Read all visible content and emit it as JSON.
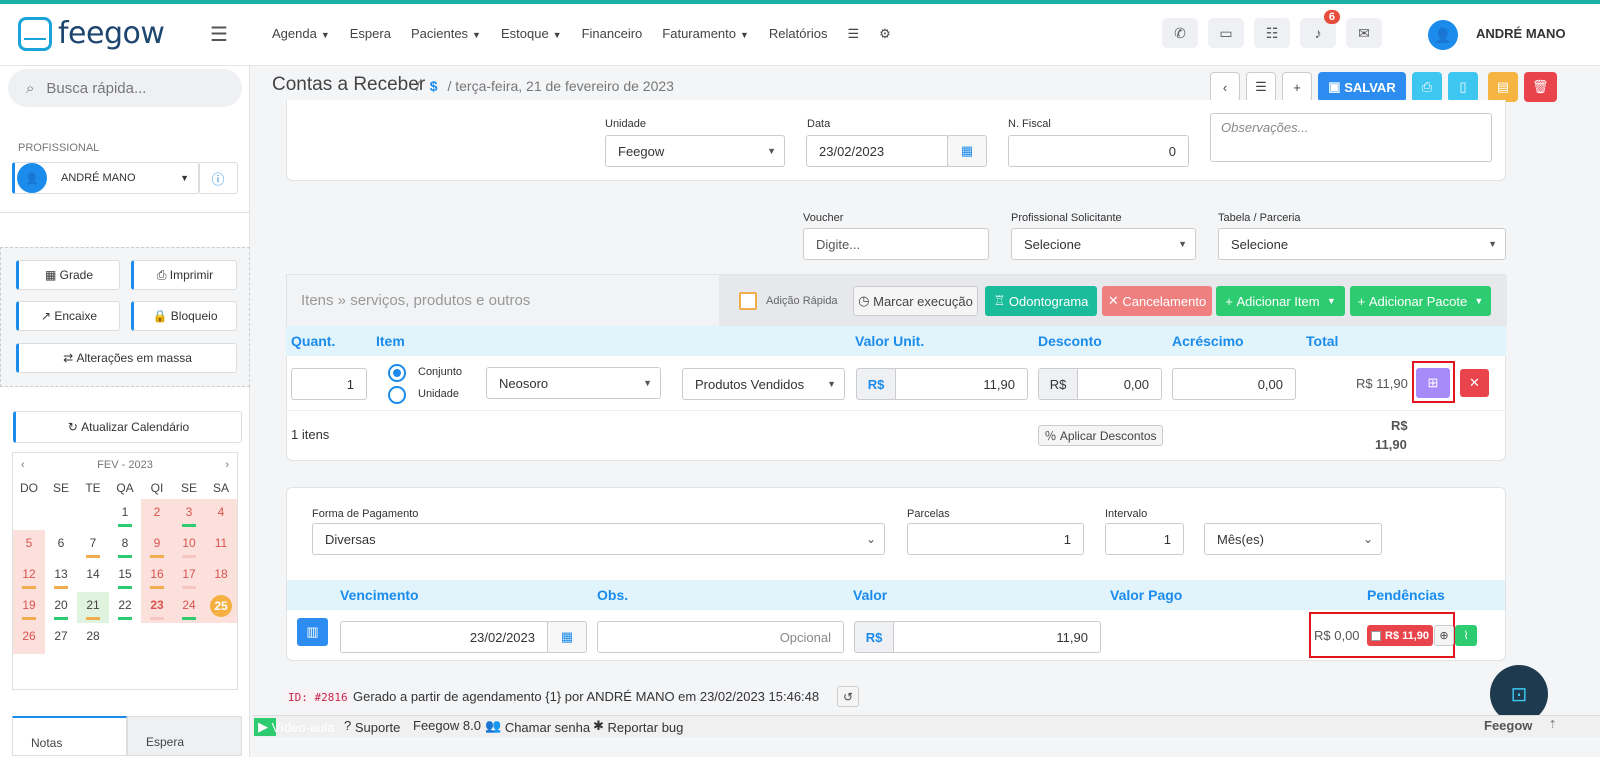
{
  "app": {
    "logo_text": "feegow",
    "user": "ANDRÉ MANO",
    "notifications_count": "6"
  },
  "nav": [
    "Agenda",
    "Espera",
    "Pacientes",
    "Estoque",
    "Financeiro",
    "Faturamento",
    "Relatórios"
  ],
  "nav_dropdowns": [
    true,
    false,
    true,
    true,
    false,
    true,
    false
  ],
  "sidebar": {
    "search_placeholder": "Busca rápida...",
    "professional_label": "PROFISSIONAL",
    "professional_value": "ANDRÉ MANO",
    "buttons": {
      "grade": "Grade",
      "imprimir": "Imprimir",
      "encaixe": "Encaixe",
      "bloqueio": "Bloqueio",
      "alteracoes": "Alterações em massa",
      "atualizar": "Atualizar Calendário"
    },
    "calendar": {
      "month": "FEV - 2023",
      "dow": [
        "DO",
        "SE",
        "TE",
        "QA",
        "QI",
        "SE",
        "SA"
      ],
      "days": [
        "",
        "",
        "",
        "1",
        "2",
        "3",
        "4",
        "5",
        "6",
        "7",
        "8",
        "9",
        "10",
        "11",
        "12",
        "13",
        "14",
        "15",
        "16",
        "17",
        "18",
        "19",
        "20",
        "21",
        "22",
        "23",
        "24",
        "25",
        "26",
        "27",
        "28",
        "",
        "",
        "",
        ""
      ]
    },
    "tabs": [
      "Notas",
      "Espera"
    ]
  },
  "header": {
    "title": "Contas a Receber",
    "icon": "dollar-icon",
    "date": "terça-feira, 21 de fevereiro de 2023",
    "save_label": "SALVAR"
  },
  "form": {
    "unidade_label": "Unidade",
    "unidade_value": "Feegow",
    "data_label": "Data",
    "data_value": "23/02/2023",
    "nfiscal_label": "N. Fiscal",
    "nfiscal_value": "0",
    "obs_placeholder": "Observações...",
    "voucher_label": "Voucher",
    "voucher_placeholder": "Digite...",
    "prof_sol_label": "Profissional Solicitante",
    "prof_sol_value": "Selecione",
    "tabela_label": "Tabela / Parceria",
    "tabela_value": "Selecione"
  },
  "items": {
    "title": "Itens » serviços, produtos e outros",
    "adicao_rapida": "Adição Rápida",
    "marcar_execucao": "Marcar execução",
    "odontograma": "Odontograma",
    "cancelamento": "Cancelamento",
    "adicionar_item": "Adicionar Item",
    "adicionar_pacote": "Adicionar Pacote",
    "columns": {
      "quant": "Quant.",
      "item": "Item",
      "valor_unit": "Valor Unit.",
      "desconto": "Desconto",
      "acrescimo": "Acréscimo",
      "total": "Total"
    },
    "row": {
      "quant": "1",
      "conjunto": "Conjunto",
      "unidade": "Unidade",
      "item": "Neosoro",
      "categoria": "Produtos Vendidos",
      "currency": "R$",
      "valor_unit": "11,90",
      "desconto": "0,00",
      "acrescimo": "0,00",
      "total": "R$ 11,90"
    },
    "count": "1 itens",
    "aplicar_descontos": "Aplicar Descontos",
    "sum_currency": "R$",
    "sum_value": "11,90"
  },
  "payment": {
    "forma_label": "Forma de Pagamento",
    "forma_value": "Diversas",
    "parcelas_label": "Parcelas",
    "parcelas_value": "1",
    "intervalo_label": "Intervalo",
    "intervalo_value": "1",
    "periodo_value": "Mês(es)",
    "columns": {
      "vencimento": "Vencimento",
      "obs": "Obs.",
      "valor": "Valor",
      "valor_pago": "Valor Pago",
      "pendencias": "Pendências"
    },
    "row": {
      "vencimento": "23/02/2023",
      "obs_placeholder": "Opcional",
      "currency": "R$",
      "valor": "11,90",
      "pago": "R$ 0,00",
      "pendente": "R$ 11,90"
    }
  },
  "log": {
    "id": "ID: #2816",
    "text": "Gerado a partir de agendamento {1} por ANDRÉ MANO em 23/02/2023 15:46:48"
  },
  "footer": {
    "video": "Vídeo-aula",
    "suporte": "Suporte",
    "versao": "Feegow 8.0",
    "chamar": "Chamar senha",
    "bug": "Reportar bug",
    "brand": "Feegow"
  },
  "colors": {
    "accent": "#1b8cec",
    "green": "#2ecc71",
    "danger": "#e9444b",
    "highlight": "#e0161c"
  }
}
